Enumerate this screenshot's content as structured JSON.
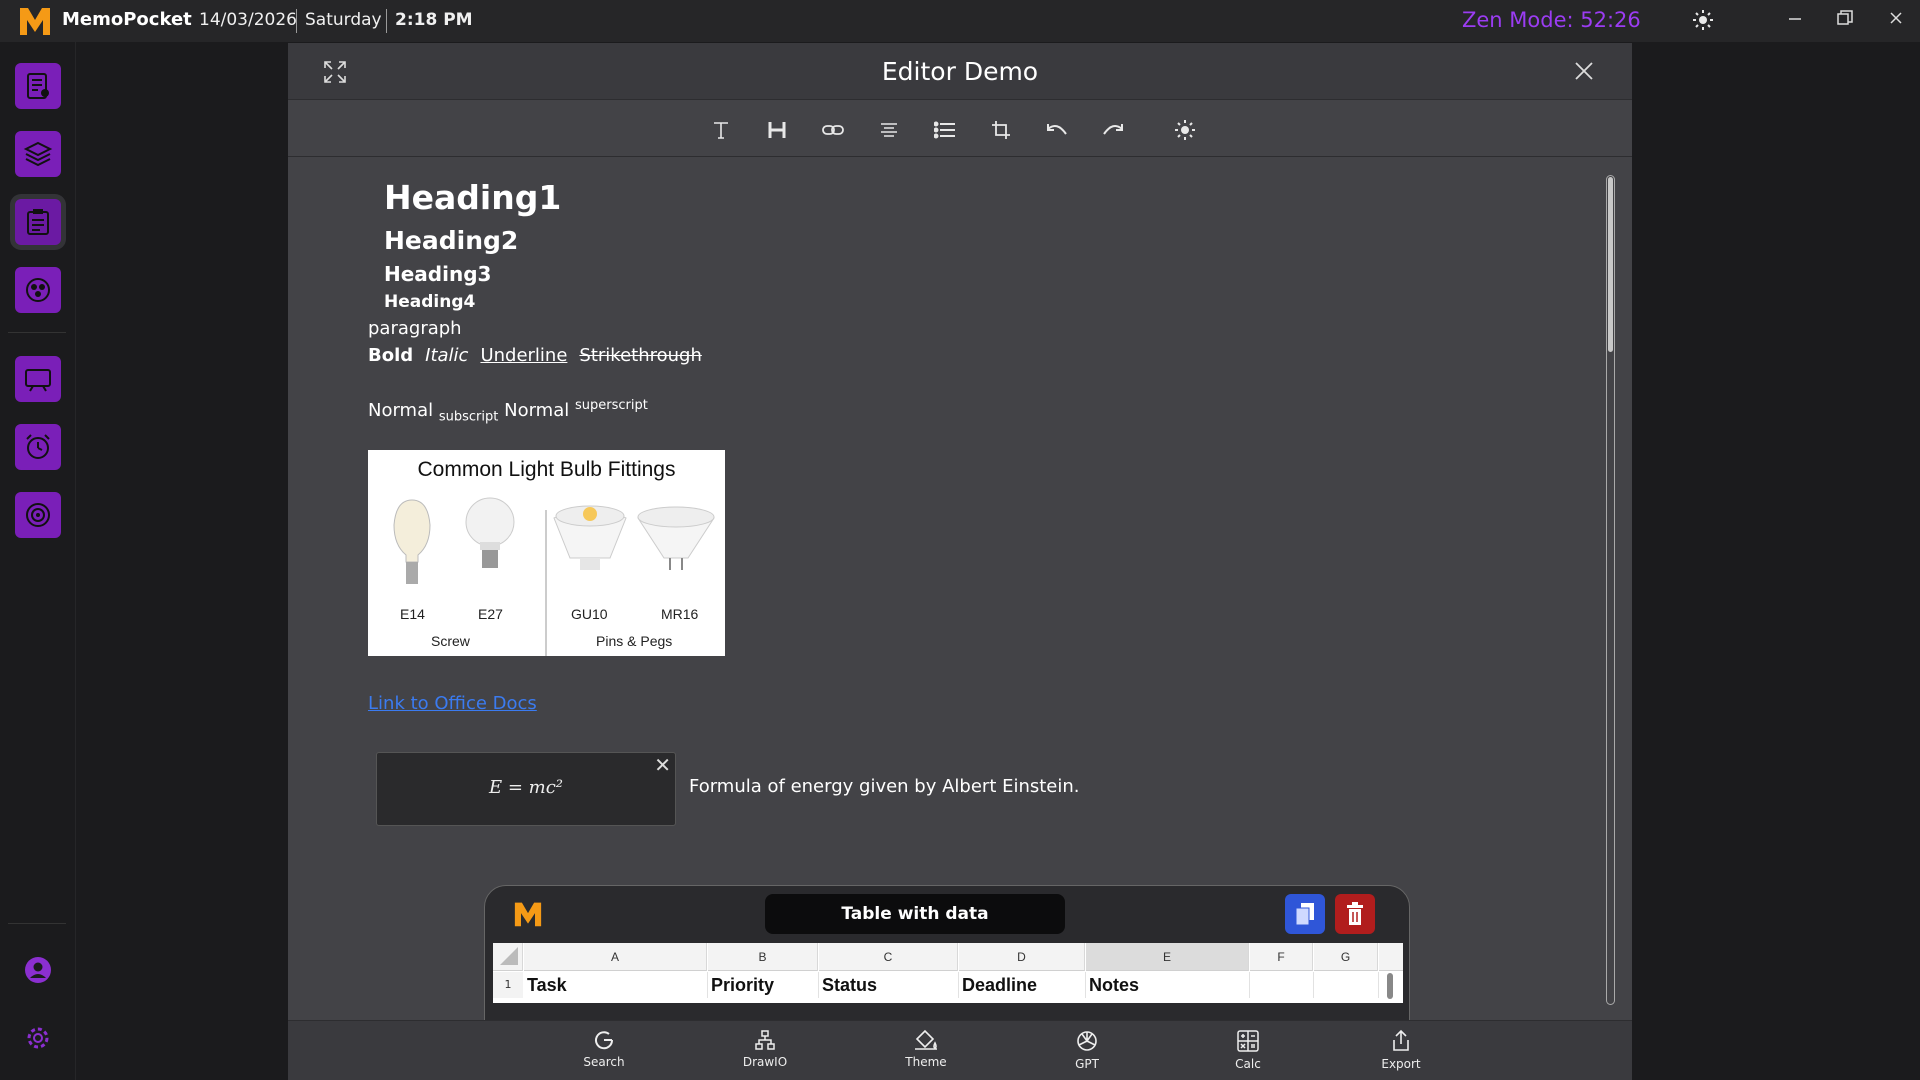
{
  "app": {
    "name": "MemoPocket",
    "date": "14/03/2026",
    "day": "Saturday",
    "time": "2:18 PM",
    "zen_mode": "Zen Mode: 52:26"
  },
  "modal": {
    "title": "Editor Demo"
  },
  "toolbar": {
    "items": [
      "text-icon",
      "heading-icon",
      "link-icon",
      "align-center-icon",
      "list-icon",
      "crop-icon",
      "undo-icon",
      "redo-icon",
      "brightness-icon"
    ]
  },
  "content": {
    "heading1": "Heading1",
    "heading2": "Heading2",
    "heading3": "Heading3",
    "heading4": "Heading4",
    "paragraph": "paragraph",
    "bold": "Bold",
    "italic": "Italic",
    "underline": "Underline",
    "strikethrough": "Strikethrough",
    "normal1": "Normal",
    "subscript": "subscript",
    "normal2": "Normal",
    "superscript": "superscript",
    "image": {
      "title": "Common Light Bulb Fittings",
      "bulbs": [
        "E14",
        "E27",
        "GU10",
        "MR16"
      ],
      "groups": [
        "Screw",
        "Pins & Pegs"
      ]
    },
    "link_text": "Link to Office Docs",
    "formula": "E = mc²",
    "formula_desc": "Formula  of energy given by Albert Einstein.",
    "sheet": {
      "title": "Table with data",
      "columns": [
        "A",
        "B",
        "C",
        "D",
        "E",
        "F",
        "G"
      ],
      "row_number": "1",
      "row1": [
        "Task",
        "Priority",
        "Status",
        "Deadline",
        "Notes",
        "",
        ""
      ]
    }
  },
  "bottombar": {
    "search": "Search",
    "drawio": "DrawIO",
    "theme": "Theme",
    "gpt": "GPT",
    "calc": "Calc",
    "export": "Export"
  },
  "colors": {
    "accent": "#7a1fb8",
    "zen": "#9b3cf2",
    "link": "#3b7bf0",
    "logo": "#f59a16"
  }
}
